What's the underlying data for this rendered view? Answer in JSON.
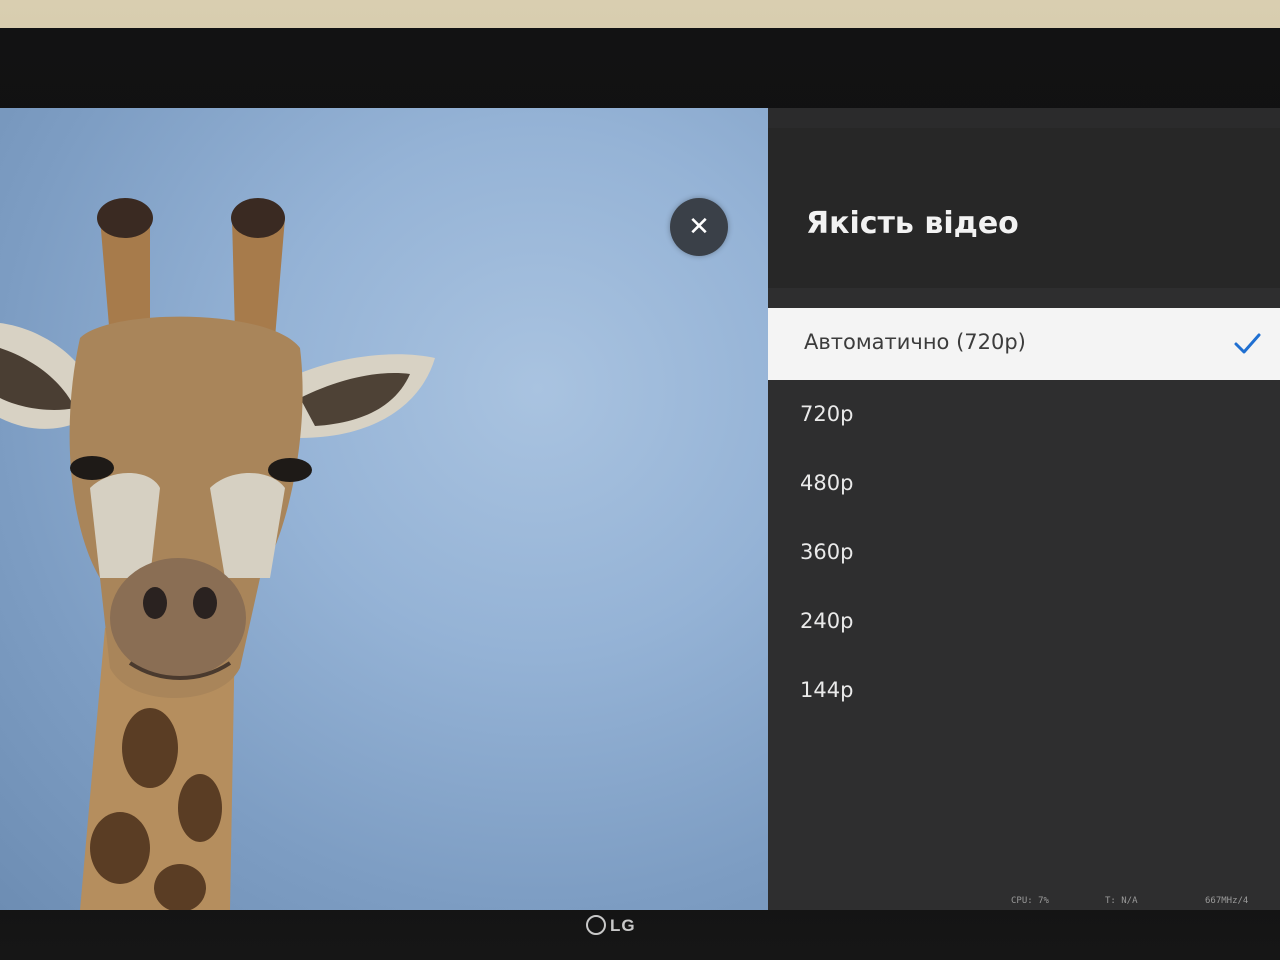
{
  "panel": {
    "title": "Якість відео",
    "options": [
      {
        "label": "Автоматично (720p)",
        "selected": true
      },
      {
        "label": "720p",
        "selected": false
      },
      {
        "label": "480p",
        "selected": false
      },
      {
        "label": "360p",
        "selected": false
      },
      {
        "label": "240p",
        "selected": false
      },
      {
        "label": "144p",
        "selected": false
      }
    ]
  },
  "close_button": {
    "icon": "close-icon",
    "glyph": "✕"
  },
  "stats": {
    "cpu": "CPU: 7%",
    "temp": "T: N/A",
    "freq": "667MHz/4"
  },
  "brand": {
    "name": "LG"
  },
  "colors": {
    "panel_bg": "#2e2e2f",
    "selected_bg": "#f4f4f4",
    "check": "#1f6fd1",
    "sky": "#95b3d6"
  }
}
